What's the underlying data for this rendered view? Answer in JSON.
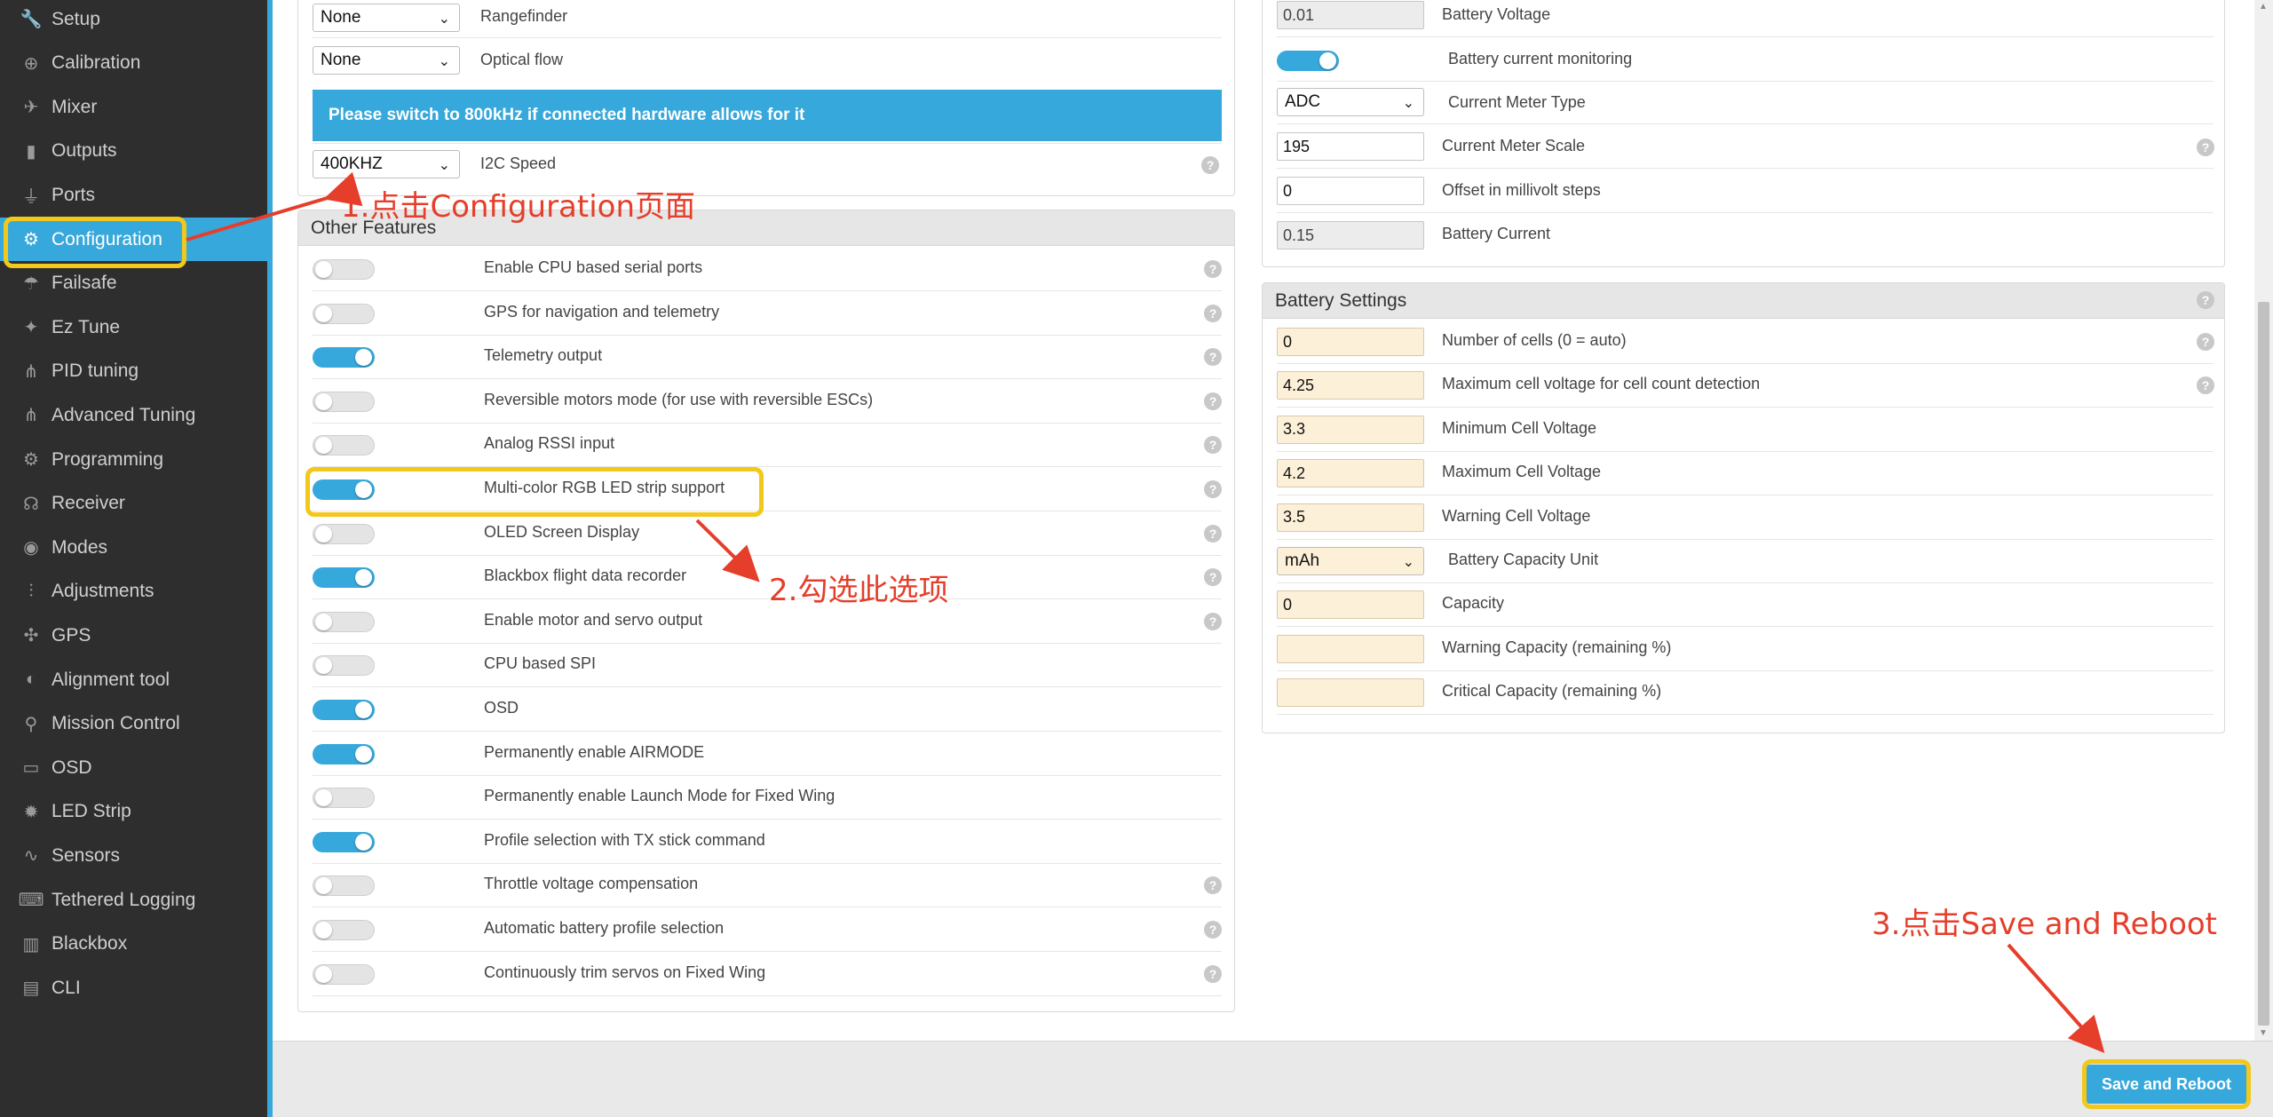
{
  "sidebar": {
    "items": [
      {
        "label": "Setup",
        "icon": "wrench-icon",
        "glyph": "🔧"
      },
      {
        "label": "Calibration",
        "icon": "crosshair-icon",
        "glyph": "⊕"
      },
      {
        "label": "Mixer",
        "icon": "mixer-icon",
        "glyph": "✈"
      },
      {
        "label": "Outputs",
        "icon": "outputs-icon",
        "glyph": "▮"
      },
      {
        "label": "Ports",
        "icon": "plug-icon",
        "glyph": "⏚"
      },
      {
        "label": "Configuration",
        "icon": "gear-icon",
        "glyph": "⚙"
      },
      {
        "label": "Failsafe",
        "icon": "parachute-icon",
        "glyph": "☂"
      },
      {
        "label": "Ez Tune",
        "icon": "magic-wand-icon",
        "glyph": "✦"
      },
      {
        "label": "PID tuning",
        "icon": "sitemap-icon",
        "glyph": "⋔"
      },
      {
        "label": "Advanced Tuning",
        "icon": "advanced-tuning-icon",
        "glyph": "⋔"
      },
      {
        "label": "Programming",
        "icon": "cog-icon",
        "glyph": "⚙"
      },
      {
        "label": "Receiver",
        "icon": "robot-icon",
        "glyph": "☊"
      },
      {
        "label": "Modes",
        "icon": "toggle-icon",
        "glyph": "◉"
      },
      {
        "label": "Adjustments",
        "icon": "sliders-icon",
        "glyph": "⫶"
      },
      {
        "label": "GPS",
        "icon": "satellite-icon",
        "glyph": "✣"
      },
      {
        "label": "Alignment tool",
        "icon": "compass-icon",
        "glyph": "◐"
      },
      {
        "label": "Mission Control",
        "icon": "map-marker-icon",
        "glyph": "⚲"
      },
      {
        "label": "OSD",
        "icon": "osd-icon",
        "glyph": "▭"
      },
      {
        "label": "LED Strip",
        "icon": "lightbulb-icon",
        "glyph": "✹"
      },
      {
        "label": "Sensors",
        "icon": "heartbeat-icon",
        "glyph": "∿"
      },
      {
        "label": "Tethered Logging",
        "icon": "keyboard-icon",
        "glyph": "⌨"
      },
      {
        "label": "Blackbox",
        "icon": "chip-icon",
        "glyph": "▥"
      },
      {
        "label": "CLI",
        "icon": "terminal-icon",
        "glyph": "▤"
      }
    ],
    "active_index": 5
  },
  "top_panel": {
    "rangefinder": {
      "value": "None",
      "label": "Rangefinder"
    },
    "optical_flow": {
      "value": "None",
      "label": "Optical flow"
    },
    "i2c_notice": "Please switch to 800kHz if connected hardware allows for it",
    "i2c_speed": {
      "value": "400KHZ",
      "label": "I2C Speed"
    }
  },
  "other_features": {
    "title": "Other Features",
    "items": [
      {
        "label": "Enable CPU based serial ports",
        "on": false,
        "help": true
      },
      {
        "label": "GPS for navigation and telemetry",
        "on": false,
        "help": true
      },
      {
        "label": "Telemetry output",
        "on": true,
        "help": true
      },
      {
        "label": "Reversible motors mode (for use with reversible ESCs)",
        "on": false,
        "help": true
      },
      {
        "label": "Analog RSSI input",
        "on": false,
        "help": true
      },
      {
        "label": "Multi-color RGB LED strip support",
        "on": true,
        "help": true
      },
      {
        "label": "OLED Screen Display",
        "on": false,
        "help": true
      },
      {
        "label": "Blackbox flight data recorder",
        "on": true,
        "help": true
      },
      {
        "label": "Enable motor and servo output",
        "on": false,
        "help": true
      },
      {
        "label": "CPU based SPI",
        "on": false,
        "help": false
      },
      {
        "label": "OSD",
        "on": true,
        "help": false
      },
      {
        "label": "Permanently enable AIRMODE",
        "on": true,
        "help": false
      },
      {
        "label": "Permanently enable Launch Mode for Fixed Wing",
        "on": false,
        "help": false
      },
      {
        "label": "Profile selection with TX stick command",
        "on": true,
        "help": false
      },
      {
        "label": "Throttle voltage compensation",
        "on": false,
        "help": true
      },
      {
        "label": "Automatic battery profile selection",
        "on": false,
        "help": true
      },
      {
        "label": "Continuously trim servos on Fixed Wing",
        "on": false,
        "help": true
      }
    ]
  },
  "battery_monitor": {
    "battery_voltage": {
      "value": "0.01",
      "label": "Battery Voltage"
    },
    "current_monitoring": {
      "label": "Battery current monitoring",
      "on": true
    },
    "current_meter_type": {
      "value": "ADC",
      "label": "Current Meter Type"
    },
    "current_meter_scale": {
      "value": "195",
      "label": "Current Meter Scale"
    },
    "offset": {
      "value": "0",
      "label": "Offset in millivolt steps"
    },
    "battery_current": {
      "value": "0.15",
      "label": "Battery Current"
    }
  },
  "battery_settings": {
    "title": "Battery Settings",
    "rows": [
      {
        "value": "0",
        "label": "Number of cells (0 = auto)",
        "kind": "input",
        "help": true
      },
      {
        "value": "4.25",
        "label": "Maximum cell voltage for cell count detection",
        "kind": "input",
        "help": true
      },
      {
        "value": "3.3",
        "label": "Minimum Cell Voltage",
        "kind": "input",
        "help": false
      },
      {
        "value": "4.2",
        "label": "Maximum Cell Voltage",
        "kind": "input",
        "help": false
      },
      {
        "value": "3.5",
        "label": "Warning Cell Voltage",
        "kind": "input",
        "help": false
      },
      {
        "value": "mAh",
        "label": "Battery Capacity Unit",
        "kind": "select",
        "help": false
      },
      {
        "value": "0",
        "label": "Capacity",
        "kind": "input",
        "help": false
      },
      {
        "value": "",
        "label": "Warning Capacity (remaining %)",
        "kind": "input",
        "help": false
      },
      {
        "value": "",
        "label": "Critical Capacity (remaining %)",
        "kind": "input",
        "help": false
      }
    ]
  },
  "footer": {
    "save_label": "Save and Reboot"
  },
  "annotations": {
    "step1": "1.点击Configuration页面",
    "step2": "2.勾选此选项",
    "step3": "3.点击Save and Reboot",
    "color": "#e53e2a",
    "highlight_color": "#f2c81b"
  },
  "colors": {
    "accent": "#37a8db",
    "sidebar_bg": "#2e2e2e"
  }
}
